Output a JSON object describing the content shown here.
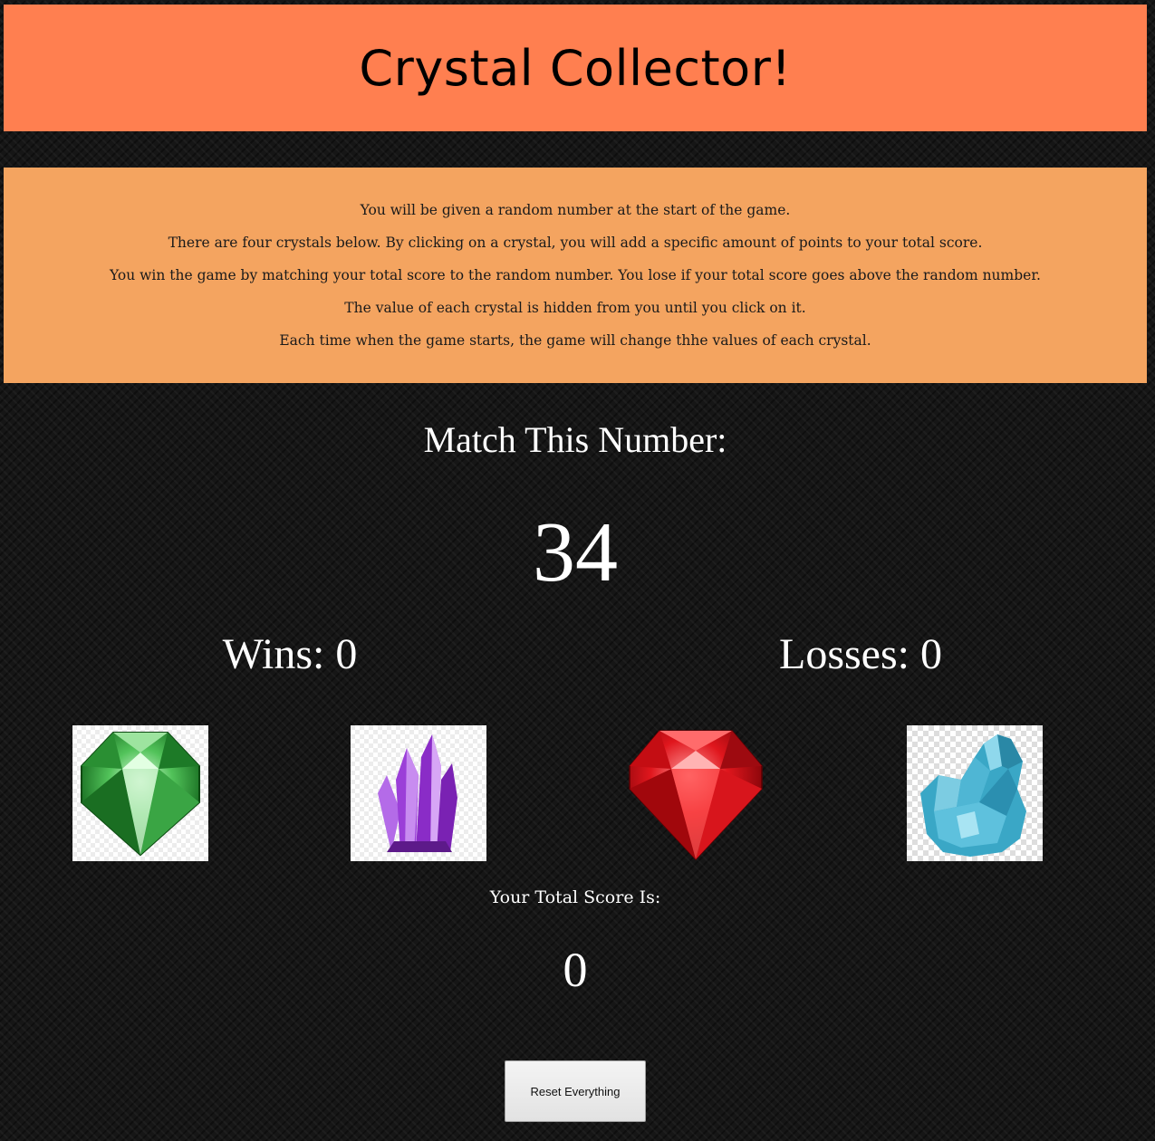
{
  "header": {
    "title": "Crystal Collector!"
  },
  "instructions": [
    "You will be given a random number at the start of the game.",
    "There are four crystals below. By clicking on a crystal, you will add a specific amount of points to your total score.",
    "You win the game by matching your total score to the random number. You lose if your total score goes above the random number.",
    "The value of each crystal is hidden from you until you click on it.",
    "Each time when the game starts, the game will change thhe values of each crystal."
  ],
  "game": {
    "match_label": "Match This Number:",
    "target_number": "34",
    "wins_text": "Wins: 0",
    "losses_text": "Losses: 0",
    "score_label": "Your Total Score Is:",
    "score_value": "0",
    "reset_label": "Reset Everything"
  },
  "crystals": [
    {
      "name": "green-crystal",
      "color": "#2e9e3a"
    },
    {
      "name": "purple-crystal",
      "color": "#a64ee0"
    },
    {
      "name": "red-crystal",
      "color": "#d0141b"
    },
    {
      "name": "blue-crystal",
      "color": "#3aa7c6"
    }
  ],
  "colors": {
    "title_bg": "#ff7f50",
    "instructions_bg": "#f4a460",
    "page_bg": "#161616"
  }
}
